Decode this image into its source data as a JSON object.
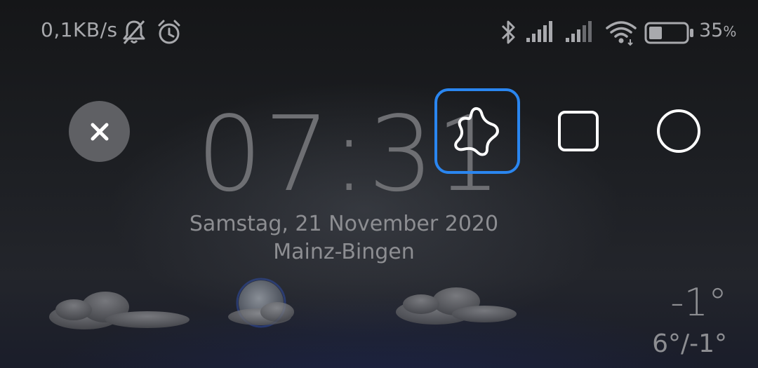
{
  "status_bar": {
    "net_speed": "0,1KB/s",
    "battery_percent": "35",
    "battery_unit": "%",
    "icons": [
      "mute-bell-icon",
      "alarm-clock-icon",
      "bluetooth-icon",
      "signal-sim1-icon",
      "signal-sim2-icon",
      "wifi-icon",
      "battery-icon"
    ],
    "battery_level": 0.35
  },
  "lockscreen": {
    "time": "07:31",
    "date": "Samstag, 21 November 2020",
    "location": "Mainz-Bingen",
    "temperature": "-1°",
    "temp_range": "6°/-1°"
  },
  "controls": {
    "close_icon": "close-icon",
    "modes": [
      {
        "icon": "freeform-star-icon",
        "selected": true
      },
      {
        "icon": "rounded-square-icon",
        "selected": false
      },
      {
        "icon": "circle-icon",
        "selected": false
      }
    ]
  },
  "colors": {
    "accent": "#2a86f0",
    "close_button_bg": "#5f6064",
    "status_text": "#a8a9ad"
  }
}
